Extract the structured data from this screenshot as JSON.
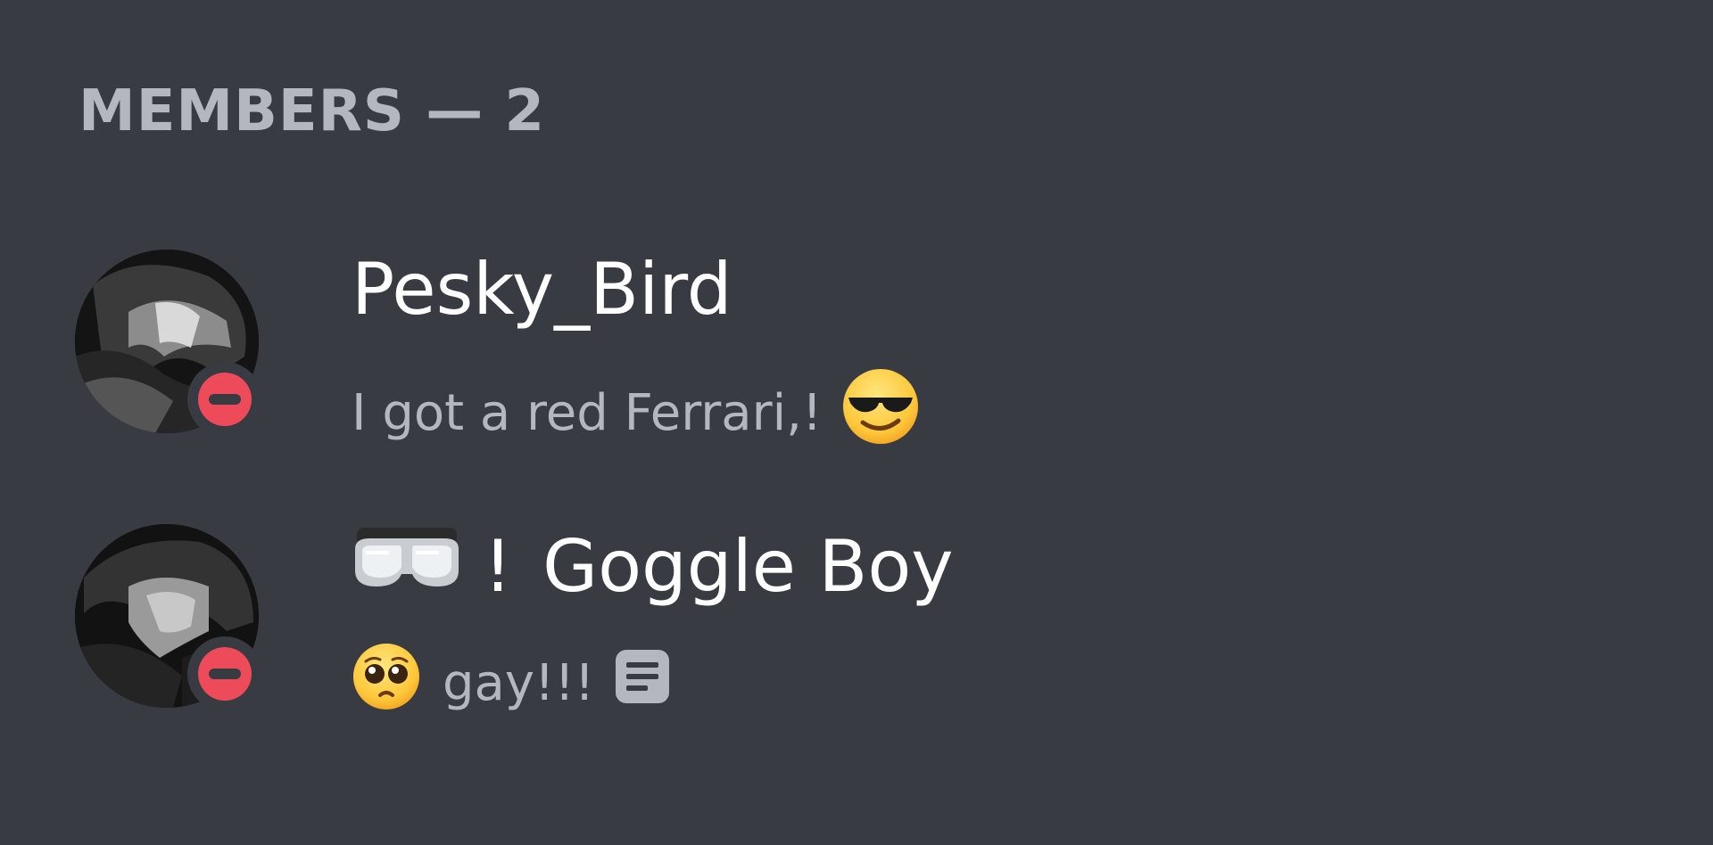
{
  "members_header": "MEMBERS — 2",
  "members": [
    {
      "name": "Pesky_Bird",
      "status_text": "I got a red Ferrari,!",
      "status_emoji": "smiling-face-with-sunglasses-icon",
      "presence": "do-not-disturb"
    },
    {
      "name_prefix_emoji": "goggles-icon",
      "name_prefix": "!",
      "name": "Goggle Boy",
      "status_emoji": "pleading-face-icon",
      "status_text": "gay!!!",
      "trailing_icon": "notes-icon",
      "presence": "do-not-disturb"
    }
  ],
  "colors": {
    "background": "#393b42",
    "header_text": "#b4b7bd",
    "name_text": "#ffffff",
    "status_text": "#b4b7bd",
    "dnd_red": "#ed4a5a"
  }
}
